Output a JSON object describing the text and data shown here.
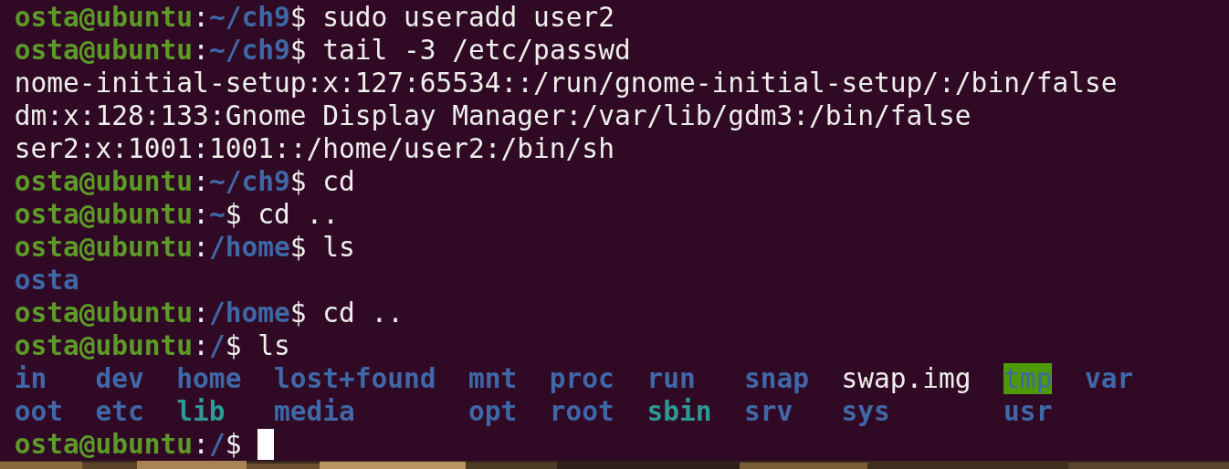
{
  "terminal": {
    "lines": [
      {
        "kind": "prompt",
        "parts": [
          {
            "text": "osta@ubuntu",
            "kind": "user"
          },
          {
            "text": ":",
            "kind": "plain"
          },
          {
            "text": "~/ch9",
            "kind": "path"
          },
          {
            "text": "$",
            "kind": "plain"
          }
        ],
        "command": "sudo useradd user2"
      },
      {
        "kind": "prompt",
        "parts": [
          {
            "text": "osta@ubuntu",
            "kind": "user"
          },
          {
            "text": ":",
            "kind": "plain"
          },
          {
            "text": "~/ch9",
            "kind": "path"
          },
          {
            "text": "$",
            "kind": "plain"
          }
        ],
        "command": "tail -3 /etc/passwd"
      },
      {
        "kind": "output",
        "text": "nome-initial-setup:x:127:65534::/run/gnome-initial-setup/:/bin/false"
      },
      {
        "kind": "output",
        "text": "dm:x:128:133:Gnome Display Manager:/var/lib/gdm3:/bin/false"
      },
      {
        "kind": "output",
        "text": "ser2:x:1001:1001::/home/user2:/bin/sh"
      },
      {
        "kind": "prompt",
        "parts": [
          {
            "text": "osta@ubuntu",
            "kind": "user"
          },
          {
            "text": ":",
            "kind": "plain"
          },
          {
            "text": "~/ch9",
            "kind": "path"
          },
          {
            "text": "$",
            "kind": "plain"
          }
        ],
        "command": "cd"
      },
      {
        "kind": "prompt",
        "parts": [
          {
            "text": "osta@ubuntu",
            "kind": "user"
          },
          {
            "text": ":",
            "kind": "plain"
          },
          {
            "text": "~",
            "kind": "path"
          },
          {
            "text": "$",
            "kind": "plain"
          }
        ],
        "command": "cd .."
      },
      {
        "kind": "prompt",
        "parts": [
          {
            "text": "osta@ubuntu",
            "kind": "user"
          },
          {
            "text": ":",
            "kind": "plain"
          },
          {
            "text": "/home",
            "kind": "path"
          },
          {
            "text": "$",
            "kind": "plain"
          }
        ],
        "command": "ls"
      },
      {
        "kind": "listing",
        "rows": [
          [
            {
              "name": "osta",
              "kind": "dir"
            }
          ]
        ]
      },
      {
        "kind": "prompt",
        "parts": [
          {
            "text": "osta@ubuntu",
            "kind": "user"
          },
          {
            "text": ":",
            "kind": "plain"
          },
          {
            "text": "/home",
            "kind": "path"
          },
          {
            "text": "$",
            "kind": "plain"
          }
        ],
        "command": "cd .."
      },
      {
        "kind": "prompt",
        "parts": [
          {
            "text": "osta@ubuntu",
            "kind": "user"
          },
          {
            "text": ":",
            "kind": "plain"
          },
          {
            "text": "/",
            "kind": "path"
          },
          {
            "text": "$",
            "kind": "plain"
          }
        ],
        "command": "ls"
      },
      {
        "kind": "listing",
        "rows": [
          [
            {
              "name": "in",
              "kind": "dir"
            },
            {
              "name": "dev",
              "kind": "dir"
            },
            {
              "name": "home",
              "kind": "dir"
            },
            {
              "name": "lost+found",
              "kind": "dir"
            },
            {
              "name": "mnt",
              "kind": "dir"
            },
            {
              "name": "proc",
              "kind": "dir"
            },
            {
              "name": "run",
              "kind": "dir"
            },
            {
              "name": "snap",
              "kind": "dir"
            },
            {
              "name": "swap.img",
              "kind": "file"
            },
            {
              "name": "tmp",
              "kind": "sticky"
            },
            {
              "name": "var",
              "kind": "dir"
            }
          ],
          [
            {
              "name": "oot",
              "kind": "dir"
            },
            {
              "name": "etc",
              "kind": "dir"
            },
            {
              "name": "lib",
              "kind": "link"
            },
            {
              "name": "media",
              "kind": "dir"
            },
            {
              "name": "opt",
              "kind": "dir"
            },
            {
              "name": "root",
              "kind": "dir"
            },
            {
              "name": "sbin",
              "kind": "link"
            },
            {
              "name": "srv",
              "kind": "dir"
            },
            {
              "name": "sys",
              "kind": "dir"
            },
            {
              "name": "usr",
              "kind": "dir"
            }
          ]
        ]
      },
      {
        "kind": "prompt",
        "parts": [
          {
            "text": "osta@ubuntu",
            "kind": "user"
          },
          {
            "text": ":",
            "kind": "plain"
          },
          {
            "text": "/",
            "kind": "path"
          },
          {
            "text": "$",
            "kind": "plain"
          }
        ],
        "cursor": true
      }
    ]
  }
}
